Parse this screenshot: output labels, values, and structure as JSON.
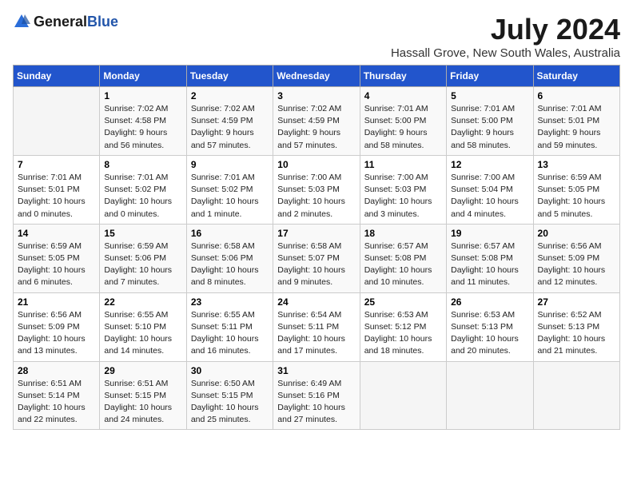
{
  "header": {
    "logo_general": "General",
    "logo_blue": "Blue",
    "month_year": "July 2024",
    "location": "Hassall Grove, New South Wales, Australia"
  },
  "days_of_week": [
    "Sunday",
    "Monday",
    "Tuesday",
    "Wednesday",
    "Thursday",
    "Friday",
    "Saturday"
  ],
  "weeks": [
    [
      {
        "day": "",
        "sunrise": "",
        "sunset": "",
        "daylight": ""
      },
      {
        "day": "1",
        "sunrise": "Sunrise: 7:02 AM",
        "sunset": "Sunset: 4:58 PM",
        "daylight": "Daylight: 9 hours and 56 minutes."
      },
      {
        "day": "2",
        "sunrise": "Sunrise: 7:02 AM",
        "sunset": "Sunset: 4:59 PM",
        "daylight": "Daylight: 9 hours and 57 minutes."
      },
      {
        "day": "3",
        "sunrise": "Sunrise: 7:02 AM",
        "sunset": "Sunset: 4:59 PM",
        "daylight": "Daylight: 9 hours and 57 minutes."
      },
      {
        "day": "4",
        "sunrise": "Sunrise: 7:01 AM",
        "sunset": "Sunset: 5:00 PM",
        "daylight": "Daylight: 9 hours and 58 minutes."
      },
      {
        "day": "5",
        "sunrise": "Sunrise: 7:01 AM",
        "sunset": "Sunset: 5:00 PM",
        "daylight": "Daylight: 9 hours and 58 minutes."
      },
      {
        "day": "6",
        "sunrise": "Sunrise: 7:01 AM",
        "sunset": "Sunset: 5:01 PM",
        "daylight": "Daylight: 9 hours and 59 minutes."
      }
    ],
    [
      {
        "day": "7",
        "sunrise": "Sunrise: 7:01 AM",
        "sunset": "Sunset: 5:01 PM",
        "daylight": "Daylight: 10 hours and 0 minutes."
      },
      {
        "day": "8",
        "sunrise": "Sunrise: 7:01 AM",
        "sunset": "Sunset: 5:02 PM",
        "daylight": "Daylight: 10 hours and 0 minutes."
      },
      {
        "day": "9",
        "sunrise": "Sunrise: 7:01 AM",
        "sunset": "Sunset: 5:02 PM",
        "daylight": "Daylight: 10 hours and 1 minute."
      },
      {
        "day": "10",
        "sunrise": "Sunrise: 7:00 AM",
        "sunset": "Sunset: 5:03 PM",
        "daylight": "Daylight: 10 hours and 2 minutes."
      },
      {
        "day": "11",
        "sunrise": "Sunrise: 7:00 AM",
        "sunset": "Sunset: 5:03 PM",
        "daylight": "Daylight: 10 hours and 3 minutes."
      },
      {
        "day": "12",
        "sunrise": "Sunrise: 7:00 AM",
        "sunset": "Sunset: 5:04 PM",
        "daylight": "Daylight: 10 hours and 4 minutes."
      },
      {
        "day": "13",
        "sunrise": "Sunrise: 6:59 AM",
        "sunset": "Sunset: 5:05 PM",
        "daylight": "Daylight: 10 hours and 5 minutes."
      }
    ],
    [
      {
        "day": "14",
        "sunrise": "Sunrise: 6:59 AM",
        "sunset": "Sunset: 5:05 PM",
        "daylight": "Daylight: 10 hours and 6 minutes."
      },
      {
        "day": "15",
        "sunrise": "Sunrise: 6:59 AM",
        "sunset": "Sunset: 5:06 PM",
        "daylight": "Daylight: 10 hours and 7 minutes."
      },
      {
        "day": "16",
        "sunrise": "Sunrise: 6:58 AM",
        "sunset": "Sunset: 5:06 PM",
        "daylight": "Daylight: 10 hours and 8 minutes."
      },
      {
        "day": "17",
        "sunrise": "Sunrise: 6:58 AM",
        "sunset": "Sunset: 5:07 PM",
        "daylight": "Daylight: 10 hours and 9 minutes."
      },
      {
        "day": "18",
        "sunrise": "Sunrise: 6:57 AM",
        "sunset": "Sunset: 5:08 PM",
        "daylight": "Daylight: 10 hours and 10 minutes."
      },
      {
        "day": "19",
        "sunrise": "Sunrise: 6:57 AM",
        "sunset": "Sunset: 5:08 PM",
        "daylight": "Daylight: 10 hours and 11 minutes."
      },
      {
        "day": "20",
        "sunrise": "Sunrise: 6:56 AM",
        "sunset": "Sunset: 5:09 PM",
        "daylight": "Daylight: 10 hours and 12 minutes."
      }
    ],
    [
      {
        "day": "21",
        "sunrise": "Sunrise: 6:56 AM",
        "sunset": "Sunset: 5:09 PM",
        "daylight": "Daylight: 10 hours and 13 minutes."
      },
      {
        "day": "22",
        "sunrise": "Sunrise: 6:55 AM",
        "sunset": "Sunset: 5:10 PM",
        "daylight": "Daylight: 10 hours and 14 minutes."
      },
      {
        "day": "23",
        "sunrise": "Sunrise: 6:55 AM",
        "sunset": "Sunset: 5:11 PM",
        "daylight": "Daylight: 10 hours and 16 minutes."
      },
      {
        "day": "24",
        "sunrise": "Sunrise: 6:54 AM",
        "sunset": "Sunset: 5:11 PM",
        "daylight": "Daylight: 10 hours and 17 minutes."
      },
      {
        "day": "25",
        "sunrise": "Sunrise: 6:53 AM",
        "sunset": "Sunset: 5:12 PM",
        "daylight": "Daylight: 10 hours and 18 minutes."
      },
      {
        "day": "26",
        "sunrise": "Sunrise: 6:53 AM",
        "sunset": "Sunset: 5:13 PM",
        "daylight": "Daylight: 10 hours and 20 minutes."
      },
      {
        "day": "27",
        "sunrise": "Sunrise: 6:52 AM",
        "sunset": "Sunset: 5:13 PM",
        "daylight": "Daylight: 10 hours and 21 minutes."
      }
    ],
    [
      {
        "day": "28",
        "sunrise": "Sunrise: 6:51 AM",
        "sunset": "Sunset: 5:14 PM",
        "daylight": "Daylight: 10 hours and 22 minutes."
      },
      {
        "day": "29",
        "sunrise": "Sunrise: 6:51 AM",
        "sunset": "Sunset: 5:15 PM",
        "daylight": "Daylight: 10 hours and 24 minutes."
      },
      {
        "day": "30",
        "sunrise": "Sunrise: 6:50 AM",
        "sunset": "Sunset: 5:15 PM",
        "daylight": "Daylight: 10 hours and 25 minutes."
      },
      {
        "day": "31",
        "sunrise": "Sunrise: 6:49 AM",
        "sunset": "Sunset: 5:16 PM",
        "daylight": "Daylight: 10 hours and 27 minutes."
      },
      {
        "day": "",
        "sunrise": "",
        "sunset": "",
        "daylight": ""
      },
      {
        "day": "",
        "sunrise": "",
        "sunset": "",
        "daylight": ""
      },
      {
        "day": "",
        "sunrise": "",
        "sunset": "",
        "daylight": ""
      }
    ]
  ]
}
